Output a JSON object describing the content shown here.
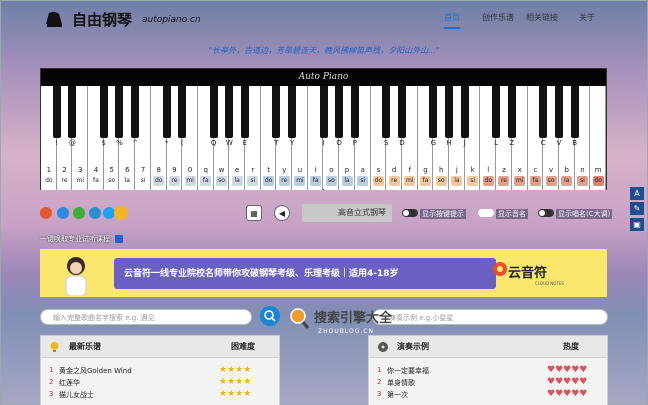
{
  "header": {
    "title": "自由钢琴",
    "subtitle": "autopiano.cn",
    "nav": [
      "首页",
      "创作乐谱",
      "相关链接",
      "关于"
    ]
  },
  "quote": "\"长亭外，古道边，芳草碧连天，晚风拂柳笛声残，夕阳山外山...\"",
  "piano": {
    "brand": "Auto Piano",
    "black_chars": [
      "!",
      "@",
      "$",
      "%",
      "^",
      "*",
      "(",
      "Q",
      "W",
      "E",
      "T",
      "Y",
      "I",
      "O",
      "P",
      "S",
      "D",
      "G",
      "H",
      "J",
      "L",
      "Z",
      "C",
      "V",
      "B"
    ],
    "white_nums": [
      "1",
      "2",
      "3",
      "4",
      "5",
      "6",
      "7",
      "8",
      "9",
      "0",
      "q",
      "w",
      "e",
      "r",
      "t",
      "y",
      "u",
      "i",
      "o",
      "p",
      "a",
      "s",
      "d",
      "f",
      "g",
      "h",
      "j",
      "k",
      "l",
      "z",
      "x",
      "c",
      "v",
      "b",
      "n",
      "m"
    ],
    "white_notes": [
      "do",
      "re",
      "mi",
      "fa",
      "so",
      "la",
      "si",
      "do",
      "re",
      "mi",
      "fa",
      "so",
      "la",
      "si",
      "do",
      "re",
      "mi",
      "fa",
      "so",
      "la",
      "si",
      "do",
      "re",
      "mi",
      "fa",
      "so",
      "la",
      "si",
      "do",
      "re",
      "mi",
      "fa",
      "so",
      "la",
      "si",
      "do"
    ]
  },
  "controls": {
    "sound": "高音立式钢琴",
    "toggle1": "显示按键提示",
    "toggle2": "显示音名",
    "toggle3": "显示唱名(C大调)"
  },
  "tutorial": "一键唤取专业试听课程",
  "banner": {
    "text": "云音符一线专业院校名师带你攻破钢琴考级、乐理考级｜适用4-18岁",
    "logo": "云音符",
    "logo_sub": "CLOUD NOTES"
  },
  "search": {
    "left_placeholder": "输入完整歌曲名字搜索  e.g. 遇见",
    "right_placeholder": "演奏示例  e.g.小星星"
  },
  "watermark": {
    "text": "搜索引擎大全",
    "sub": "ZHOUBLOG.CN"
  },
  "panel_left": {
    "title": "最新乐谱",
    "col": "困难度",
    "rows": [
      {
        "n": "1",
        "name": "黄金之风Golden Wind"
      },
      {
        "n": "2",
        "name": "红莲华"
      },
      {
        "n": "3",
        "name": "猫儿女战士"
      }
    ]
  },
  "panel_right": {
    "title": "演奏示例",
    "col": "热度",
    "rows": [
      {
        "n": "1",
        "name": "你一定要幸福"
      },
      {
        "n": "2",
        "name": "单身情歌"
      },
      {
        "n": "3",
        "name": "第一次"
      }
    ]
  },
  "colors": {
    "accent": "#1a6fd0",
    "banner": "#fbe66e",
    "banner_mid": "#6a60c4"
  }
}
